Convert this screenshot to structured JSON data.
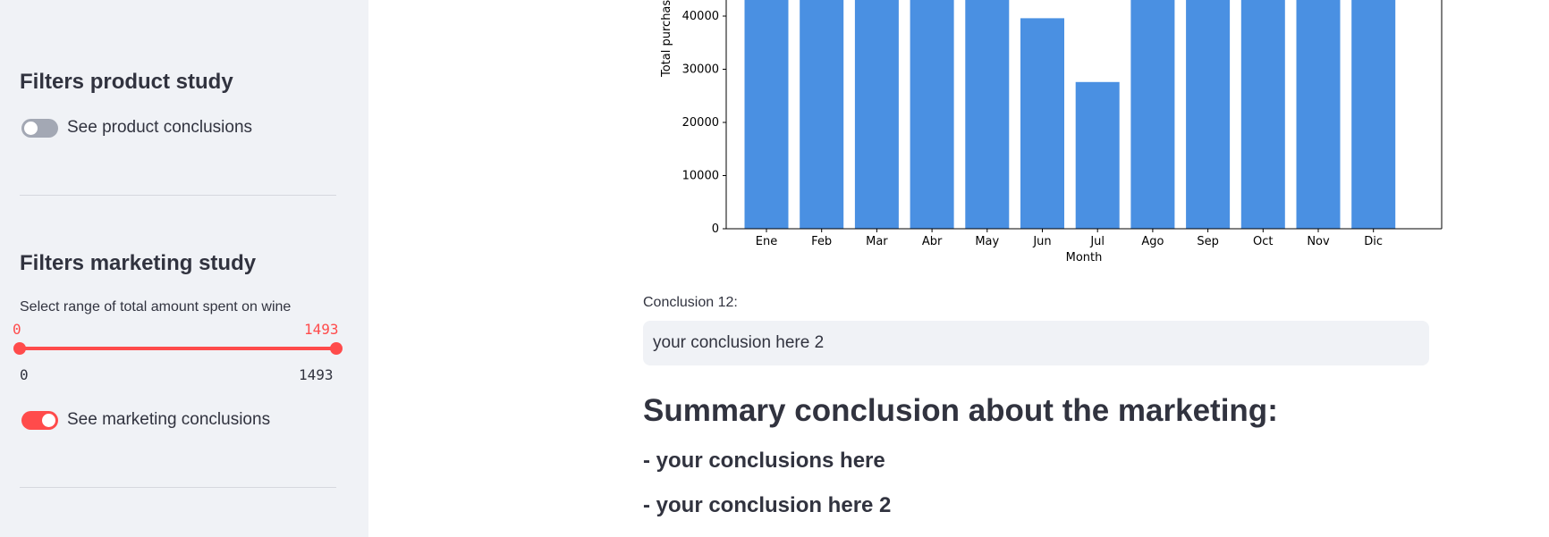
{
  "sidebar": {
    "product_heading": "Filters product study",
    "product_toggle": {
      "label": "See product conclusions",
      "on": false
    },
    "marketing_heading": "Filters marketing study",
    "slider": {
      "caption": "Select range of total amount spent on wine",
      "min": 0,
      "max": 1493,
      "low": 0,
      "high": 1493,
      "low_label": "0",
      "high_label": "1493",
      "min_label": "0",
      "max_label": "1493"
    },
    "marketing_toggle": {
      "label": "See marketing conclusions",
      "on": true
    }
  },
  "colors": {
    "accent": "#ff4b4b",
    "bar": "#4a90e2",
    "sidebar_bg": "#f0f2f6",
    "text": "#31333f"
  },
  "chart_data": {
    "type": "bar",
    "categories": [
      "Ene",
      "Feb",
      "Mar",
      "Abr",
      "May",
      "Jun",
      "Jul",
      "Ago",
      "Sep",
      "Oct",
      "Nov",
      "Dic"
    ],
    "values": [
      43700,
      43700,
      43700,
      43700,
      43700,
      39600,
      27600,
      43700,
      43700,
      43700,
      43700,
      43700
    ],
    "xlabel": "Month",
    "ylabel": "Total purchase",
    "yticks": [
      0,
      10000,
      20000,
      30000,
      40000
    ],
    "ylim": [
      0,
      43700
    ],
    "color": "#4a90e2"
  },
  "main": {
    "conclusion_label": "Conclusion 12:",
    "conclusion_value": "your conclusion here 2",
    "summary_heading": "Summary conclusion about the marketing:",
    "bullets": [
      "- your conclusions here",
      "- your conclusion here 2"
    ]
  }
}
